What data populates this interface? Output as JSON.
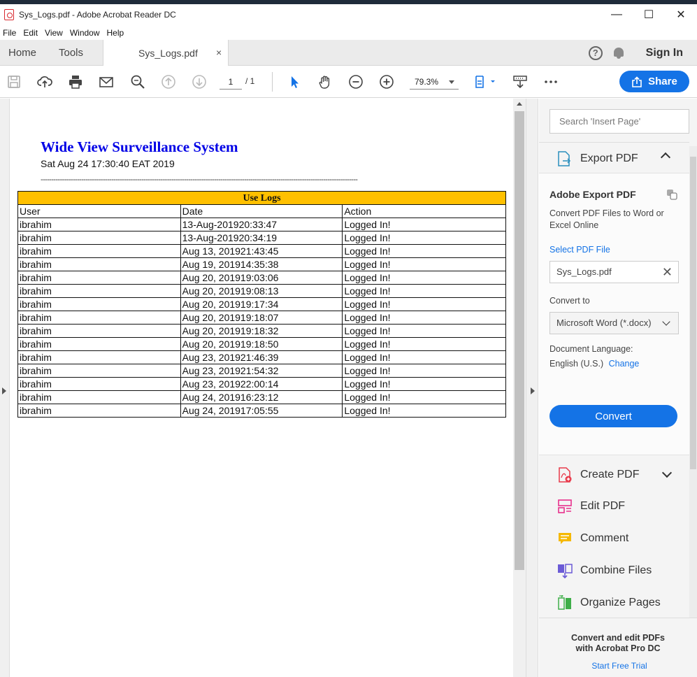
{
  "window": {
    "title": "Sys_Logs.pdf - Adobe Acrobat Reader DC",
    "minimize": "—",
    "maximize": "☐",
    "close": "✕"
  },
  "menu": [
    "File",
    "Edit",
    "View",
    "Window",
    "Help"
  ],
  "tabs": {
    "home": "Home",
    "tools": "Tools",
    "document": "Sys_Logs.pdf",
    "close": "×",
    "help": "?",
    "signin": "Sign In"
  },
  "toolbar": {
    "page_current": "1",
    "page_total": "/ 1",
    "zoom": "79.3%",
    "share": "Share",
    "icons": [
      "save-icon",
      "upload-cloud-icon",
      "print-icon",
      "email-icon",
      "search-zoom-icon",
      "page-up-icon",
      "page-down-icon",
      "select-arrow-icon",
      "hand-icon",
      "zoom-out-icon",
      "zoom-in-icon",
      "fit-page-icon",
      "scroll-mode-icon",
      "more-icon"
    ]
  },
  "document": {
    "title": "Wide View Surveillance System",
    "timestamp": "Sat Aug 24 17:30:40 EAT 2019",
    "rule": "----------------------------------------------------------------------------------------------------------------------------------------------------",
    "table": {
      "caption": "Use Logs",
      "headers": [
        "User",
        "Date",
        "Action"
      ],
      "rows": [
        [
          "ibrahim",
          "13-Aug-201920:33:47",
          "Logged In!"
        ],
        [
          "ibrahim",
          "13-Aug-201920:34:19",
          "Logged In!"
        ],
        [
          "ibrahim",
          "Aug 13, 201921:43:45",
          "Logged In!"
        ],
        [
          "ibrahim",
          "Aug 19, 201914:35:38",
          "Logged In!"
        ],
        [
          "ibrahim",
          "Aug 20, 201919:03:06",
          "Logged In!"
        ],
        [
          "ibrahim",
          "Aug 20, 201919:08:13",
          "Logged In!"
        ],
        [
          "ibrahim",
          "Aug 20, 201919:17:34",
          "Logged In!"
        ],
        [
          "ibrahim",
          "Aug 20, 201919:18:07",
          "Logged In!"
        ],
        [
          "ibrahim",
          "Aug 20, 201919:18:32",
          "Logged In!"
        ],
        [
          "ibrahim",
          "Aug 20, 201919:18:50",
          "Logged In!"
        ],
        [
          "ibrahim",
          "Aug 23, 201921:46:39",
          "Logged In!"
        ],
        [
          "ibrahim",
          "Aug 23, 201921:54:32",
          "Logged In!"
        ],
        [
          "ibrahim",
          "Aug 23, 201922:00:14",
          "Logged In!"
        ],
        [
          "ibrahim",
          "Aug 24, 201916:23:12",
          "Logged In!"
        ],
        [
          "ibrahim",
          "Aug 24, 201917:05:55",
          "Logged In!"
        ]
      ]
    }
  },
  "right_panel": {
    "search_placeholder": "Search 'Insert Page'",
    "export": {
      "header": "Export PDF",
      "title": "Adobe Export PDF",
      "description": "Convert PDF Files to Word or Excel Online",
      "select_file": "Select PDF File",
      "file_name": "Sys_Logs.pdf",
      "file_clear": "✕",
      "convert_to_label": "Convert to",
      "format": "Microsoft Word (*.docx)",
      "language_label": "Document Language:",
      "language_value": "English (U.S.)",
      "language_change": "Change",
      "convert_button": "Convert"
    },
    "tools": [
      {
        "label": "Create PDF",
        "icon": "create-pdf-icon",
        "color": "#e8394a"
      },
      {
        "label": "Edit PDF",
        "icon": "edit-pdf-icon",
        "color": "#e8308c"
      },
      {
        "label": "Comment",
        "icon": "comment-icon",
        "color": "#f5b800"
      },
      {
        "label": "Combine Files",
        "icon": "combine-files-icon",
        "color": "#6b5bd6"
      },
      {
        "label": "Organize Pages",
        "icon": "organize-pages-icon",
        "color": "#3fae49"
      }
    ],
    "promo": {
      "line1": "Convert and edit PDFs",
      "line2": "with Acrobat Pro DC",
      "link": "Start Free Trial"
    }
  },
  "colors": {
    "accent": "#1473e6",
    "table_caption_bg": "#ffc000",
    "doc_title": "#0000e6"
  }
}
